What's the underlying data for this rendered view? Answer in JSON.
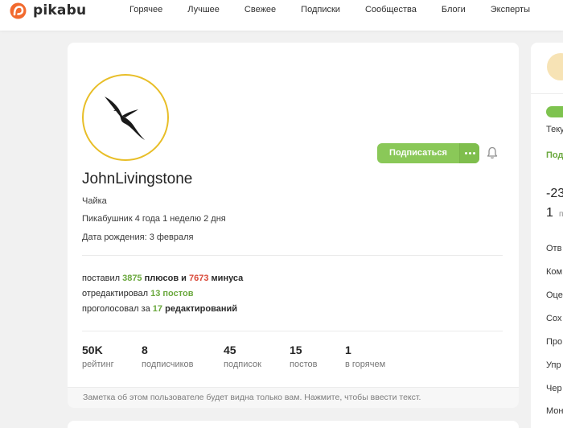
{
  "header": {
    "logo_text": "pikabu",
    "brand_color": "#f26a2e",
    "nav": [
      "Горячее",
      "Лучшее",
      "Свежее",
      "Подписки",
      "Сообщества",
      "Блоги",
      "Эксперты"
    ]
  },
  "profile": {
    "username": "JohnLivingstone",
    "avatar_ring_color": "#e8be28",
    "status": "Чайка",
    "membership": "Пикабушник 4 года 1 неделю 2 дня",
    "birthday": "Дата рождения: 3 февраля",
    "subscribe_label": "Подписаться",
    "subscribe_color": "#8ac858",
    "activity": {
      "line1_prefix": "поставил",
      "plus_count": "3875",
      "line1_mid": "плюсов и",
      "minus_count": "7673",
      "line1_suffix": "минуса",
      "line2_prefix": "отредактировал",
      "edited_posts": "13 постов",
      "line3_prefix": "проголосовал за",
      "voted_count": "17",
      "line3_suffix": "редактирований"
    },
    "counters": [
      {
        "value": "50K",
        "label": "рейтинг"
      },
      {
        "value": "8",
        "label": "подписчиков"
      },
      {
        "value": "45",
        "label": "подписок"
      },
      {
        "value": "15",
        "label": "постов"
      },
      {
        "value": "1",
        "label": "в горячем"
      }
    ],
    "note_hint": "Заметка об этом пользователе будет видна только вам. Нажмите, чтобы ввести текст."
  },
  "sidebar": {
    "text1": "Теку",
    "link1": "Под",
    "big1": "-23",
    "big2": "1",
    "big2_small": "п",
    "items": [
      "Отв",
      "Ком",
      "Оце",
      "Сох",
      "Про",
      "Упр",
      "Чер",
      "Мон"
    ]
  }
}
